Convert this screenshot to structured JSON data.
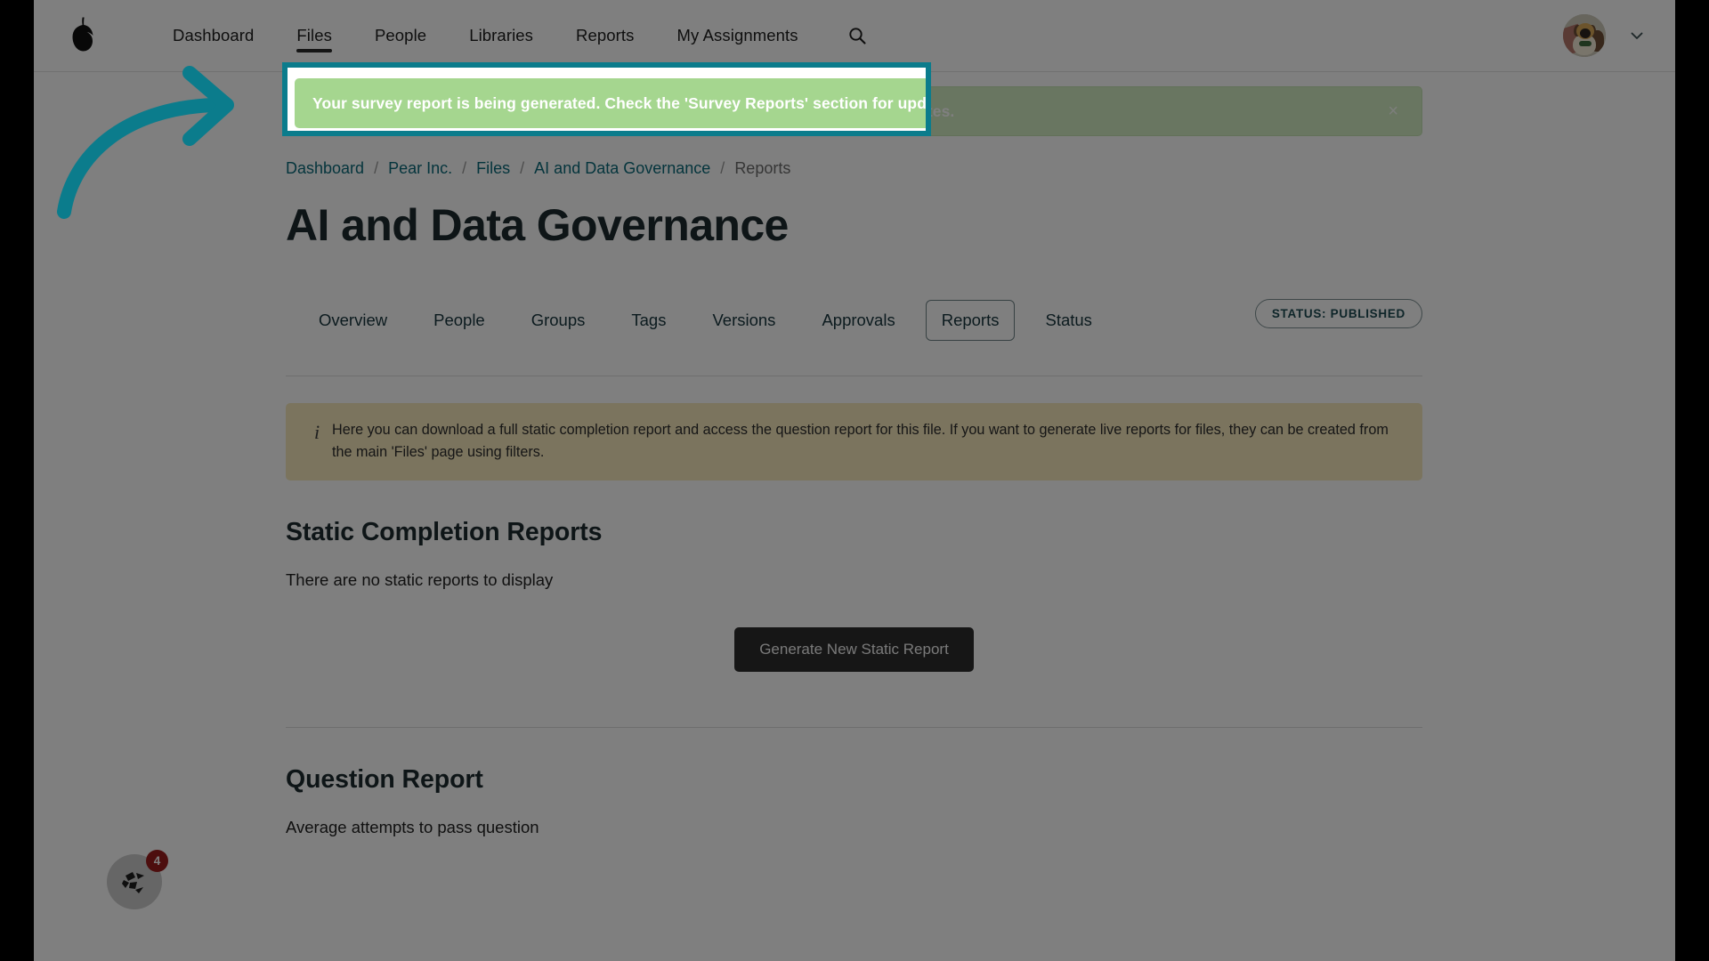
{
  "nav": {
    "logo_icon": "pear-logo-icon",
    "links": [
      {
        "label": "Dashboard",
        "active": false
      },
      {
        "label": "Files",
        "active": true
      },
      {
        "label": "People",
        "active": false
      },
      {
        "label": "Libraries",
        "active": false
      },
      {
        "label": "Reports",
        "active": false
      },
      {
        "label": "My Assignments",
        "active": false
      }
    ],
    "search_icon": "search-icon",
    "avatar_alt": "user-avatar",
    "chevron_icon": "chevron-down-icon"
  },
  "alert": {
    "message": "Your survey report is being generated. Check the 'Survey Reports' section for updates.",
    "close_label": "×",
    "background_color": "#a5d68f",
    "text_color": "#ffffff"
  },
  "breadcrumb": {
    "items": [
      {
        "label": "Dashboard",
        "current": false
      },
      {
        "label": "Pear Inc.",
        "current": false
      },
      {
        "label": "Files",
        "current": false
      },
      {
        "label": "AI and Data Governance",
        "current": false
      },
      {
        "label": "Reports",
        "current": true
      }
    ],
    "separator": "/",
    "link_color": "#0b6a7a"
  },
  "page": {
    "title": "AI and Data Governance"
  },
  "tabs": {
    "items": [
      {
        "label": "Overview",
        "selected": false
      },
      {
        "label": "People",
        "selected": false
      },
      {
        "label": "Groups",
        "selected": false
      },
      {
        "label": "Tags",
        "selected": false
      },
      {
        "label": "Versions",
        "selected": false
      },
      {
        "label": "Approvals",
        "selected": false
      },
      {
        "label": "Reports",
        "selected": true
      },
      {
        "label": "Status",
        "selected": false
      }
    ],
    "status_badge": "STATUS: PUBLISHED"
  },
  "info_box": {
    "icon": "info-icon",
    "text": "Here you can download a full static completion report and access the question report for this file. If you want to generate live reports for files, they can be created from the main 'Files' page using filters.",
    "background_color": "#f6e8bd"
  },
  "static_reports": {
    "heading": "Static Completion Reports",
    "empty_message": "There are no static reports to display",
    "generate_button": "Generate New Static Report"
  },
  "question_report": {
    "heading": "Question Report",
    "subtitle": "Average attempts to pass question"
  },
  "helper_widget": {
    "icon": "chameleon-logo-icon",
    "badge_count": "4",
    "badge_color": "#9b1c1c"
  },
  "annotation": {
    "arrow_icon": "curved-arrow-icon",
    "highlight_color": "#0b7c8c"
  }
}
